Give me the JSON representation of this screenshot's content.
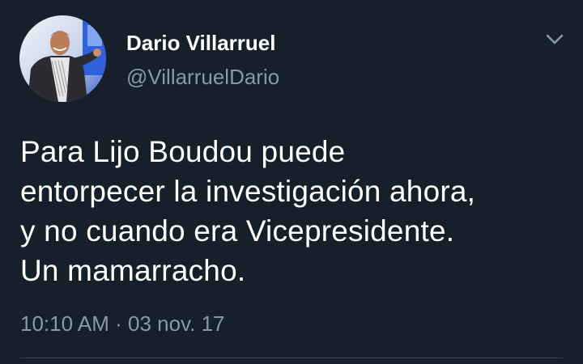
{
  "user": {
    "display_name": "Dario Villarruel",
    "handle": "@VillarruelDario",
    "avatar_icon": "profile-photo"
  },
  "tweet": {
    "lines": [
      "Para Lijo Boudou puede",
      "entorpecer la investigación ahora,",
      "y no cuando era Vicepresidente.",
      "Un mamarracho."
    ],
    "time": "10:10 AM",
    "separator": "·",
    "date": "03 nov. 17"
  },
  "menu": {
    "icon": "chevron-down-icon"
  },
  "colors": {
    "background": "#15202b",
    "primary_text": "#ffffff",
    "secondary_text": "#8899a6",
    "divider": "#38444d"
  }
}
